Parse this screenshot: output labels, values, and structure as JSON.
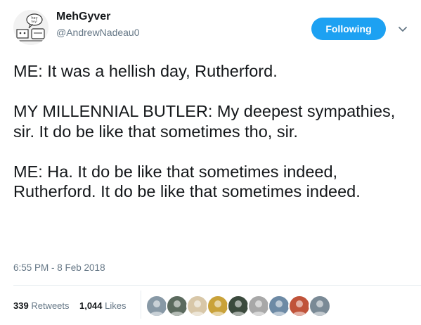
{
  "author": {
    "display_name": "MehGyver",
    "handle": "@AndrewNadeau0",
    "avatar_icon": "cartoon-avatar"
  },
  "follow_button": {
    "label": "Following",
    "color": "#1da1f2"
  },
  "menu_icon": "chevron-down-icon",
  "tweet": {
    "paragraphs": [
      "ME: It was a hellish day, Rutherford.",
      "MY MILLENNIAL BUTLER: My deepest sympathies, sir. It do be like that sometimes tho, sir.",
      "ME: Ha. It do be like that sometimes indeed, Rutherford. It do be like that sometimes indeed."
    ],
    "timestamp": "6:55 PM - 8 Feb 2018"
  },
  "stats": {
    "retweets_count": "339",
    "retweets_label": "Retweets",
    "likes_count": "1,044",
    "likes_label": "Likes"
  },
  "liker_avatars": [
    {
      "icon": "default-avatar-icon",
      "color": "#8899a6"
    },
    {
      "icon": "user-avatar-icon",
      "color": "#5b6a5e"
    },
    {
      "icon": "user-avatar-icon",
      "color": "#d8c7a8"
    },
    {
      "icon": "user-avatar-icon",
      "color": "#c9a23a"
    },
    {
      "icon": "user-avatar-icon",
      "color": "#3b4a3d"
    },
    {
      "icon": "user-avatar-icon",
      "color": "#a8a8a8"
    },
    {
      "icon": "user-avatar-icon",
      "color": "#6d8aa5"
    },
    {
      "icon": "user-avatar-icon",
      "color": "#c0533a"
    },
    {
      "icon": "user-avatar-icon",
      "color": "#7a8a96"
    }
  ]
}
